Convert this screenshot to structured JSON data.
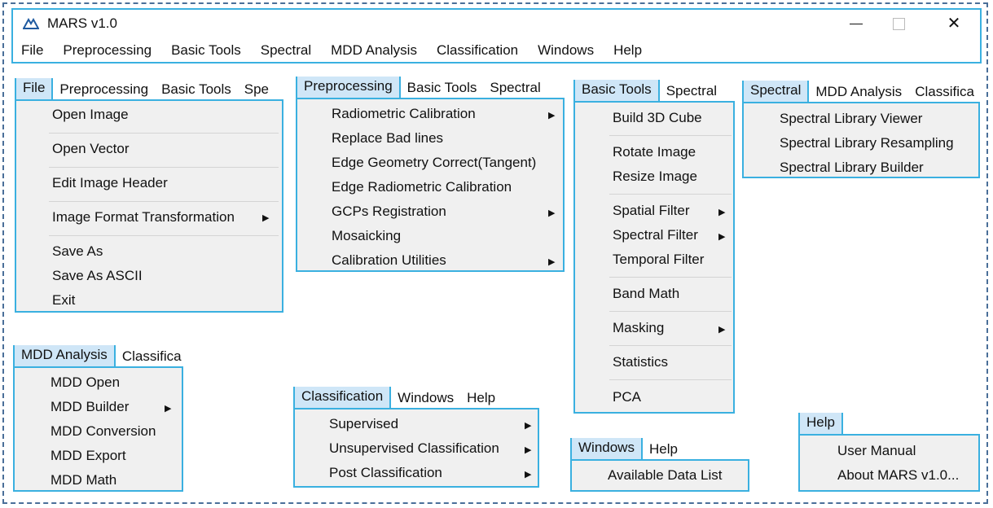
{
  "app": {
    "title": "MARS v1.0",
    "close_glyph": "✕",
    "menu": [
      "File",
      "Preprocessing",
      "Basic Tools",
      "Spectral",
      "MDD Analysis",
      "Classification",
      "Windows",
      "Help"
    ]
  },
  "submenu_arrow": "▶",
  "panels": {
    "file": {
      "tabs": [
        "File",
        "Preprocessing",
        "Basic Tools",
        "Spe"
      ],
      "items": [
        "Open Image",
        "Open Vector",
        "Edit Image Header",
        "Image Format Transformation",
        "Save As",
        "Save As ASCII",
        "Exit"
      ]
    },
    "preprocessing": {
      "tabs": [
        "Preprocessing",
        "Basic Tools",
        "Spectral"
      ],
      "items": [
        "Radiometric Calibration",
        "Replace Bad lines",
        "Edge Geometry Correct(Tangent)",
        "Edge Radiometric Calibration",
        "GCPs Registration",
        "Mosaicking",
        "Calibration Utilities"
      ]
    },
    "basic_tools": {
      "tabs": [
        "Basic Tools",
        "Spectral"
      ],
      "items": [
        "Build 3D Cube",
        "Rotate Image",
        "Resize Image",
        "Spatial Filter",
        "Spectral Filter",
        "Temporal Filter",
        "Band Math",
        "Masking",
        "Statistics",
        "PCA"
      ]
    },
    "spectral": {
      "tabs": [
        "Spectral",
        "MDD Analysis",
        "Classifica"
      ],
      "items": [
        "Spectral Library Viewer",
        "Spectral Library Resampling",
        "Spectral Library Builder"
      ]
    },
    "mdd": {
      "tabs": [
        "MDD Analysis",
        "Classifica"
      ],
      "items": [
        "MDD Open",
        "MDD Builder",
        "MDD Conversion",
        "MDD Export",
        "MDD Math"
      ]
    },
    "classification": {
      "tabs": [
        "Classification",
        "Windows",
        "Help"
      ],
      "items": [
        "Supervised",
        "Unsupervised Classification",
        "Post Classification"
      ]
    },
    "windows": {
      "tabs": [
        "Windows",
        "Help"
      ],
      "items": [
        "Available Data List"
      ]
    },
    "help": {
      "tabs": [
        "Help"
      ],
      "items": [
        "User Manual",
        "About MARS v1.0..."
      ]
    }
  }
}
